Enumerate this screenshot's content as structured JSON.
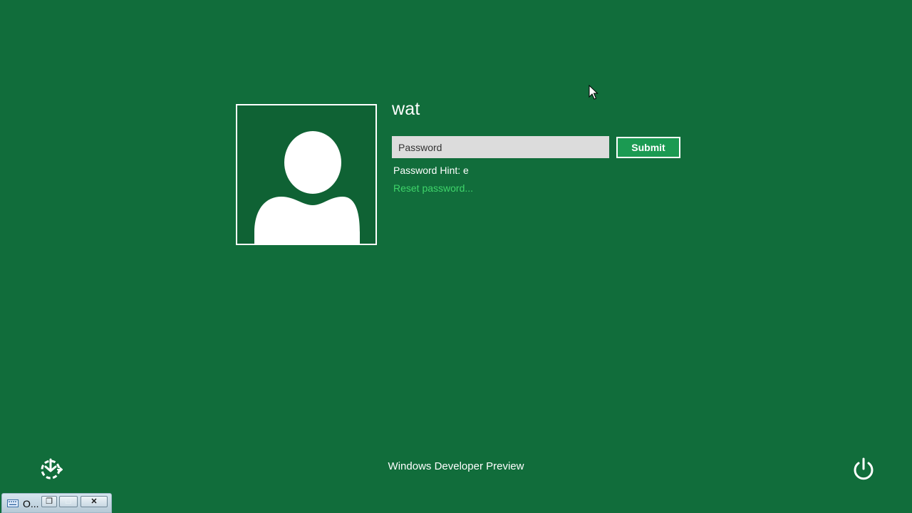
{
  "user": {
    "name": "wat"
  },
  "login": {
    "password_placeholder": "Password",
    "submit_label": "Submit",
    "hint_text": "Password Hint: e",
    "reset_link_text": "Reset password..."
  },
  "footer": {
    "text": "Windows Developer Preview"
  },
  "icons": {
    "ease_of_access": "ease-of-access-icon",
    "power": "power-icon",
    "avatar": "user-avatar-placeholder"
  },
  "osk_window": {
    "title": "O...",
    "close_glyph": "✕",
    "restore_glyph": "❐",
    "maximize_glyph": "☐"
  },
  "colors": {
    "background": "#116d3b",
    "avatar_background": "#0f6234",
    "submit_background": "#1b9a52",
    "link": "#3fd46a"
  }
}
